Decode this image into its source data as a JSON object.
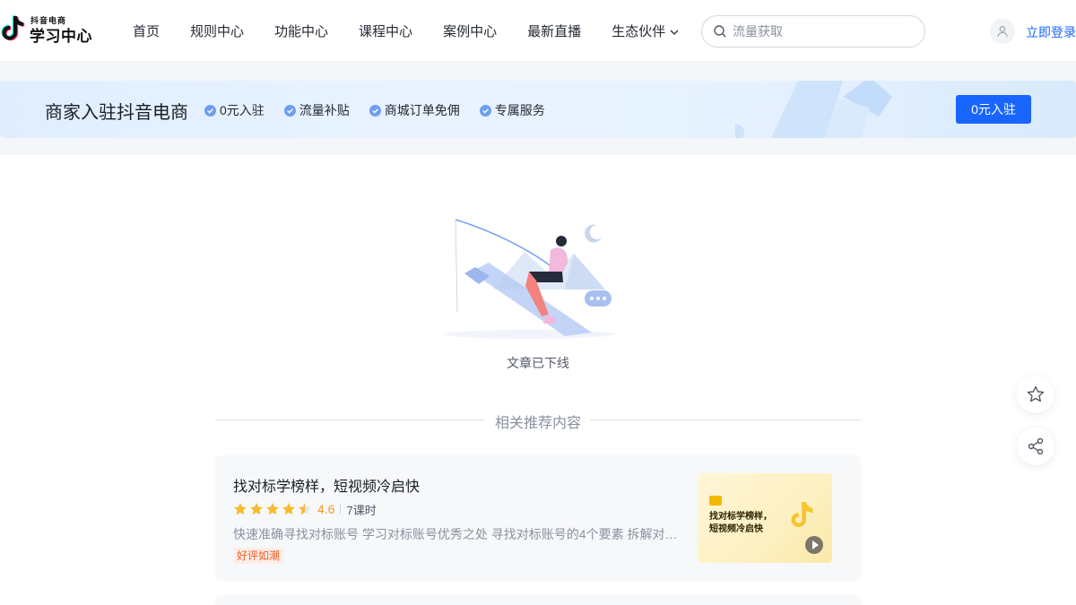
{
  "header": {
    "logo_small": "抖音电商",
    "logo_big": "学习中心",
    "nav": [
      {
        "label": "首页"
      },
      {
        "label": "规则中心"
      },
      {
        "label": "功能中心"
      },
      {
        "label": "课程中心"
      },
      {
        "label": "案例中心"
      },
      {
        "label": "最新直播"
      },
      {
        "label": "生态伙伴"
      }
    ],
    "search_placeholder": "流量获取",
    "login_label": "立即登录",
    "icons": {
      "search": "search-icon",
      "avatar": "user-icon",
      "dropdown": "chevron-down-icon"
    }
  },
  "banner": {
    "title": "商家入驻抖音电商",
    "benefits": [
      "0元入驻",
      "流量补贴",
      "商城订单免佣",
      "专属服务"
    ],
    "button_label": "0元入驻",
    "accent": "#1966ff"
  },
  "main": {
    "empty_text": "文章已下线",
    "related_title": "相关推荐内容",
    "cards": [
      {
        "title": "找对标学榜样，短视频冷启快",
        "rating": 4.5,
        "score": "4.6",
        "lessons": "7课时",
        "description": "快速准确寻找对标账号 学习对标账号优秀之处 寻找对标账号的4个要素 拆解对标账号的方法论",
        "tag": "好评如潮",
        "thumb_title": "找对标学榜样，\n短视频冷启快"
      }
    ]
  },
  "floating": {
    "icons": [
      "star-icon",
      "share-icon"
    ]
  }
}
